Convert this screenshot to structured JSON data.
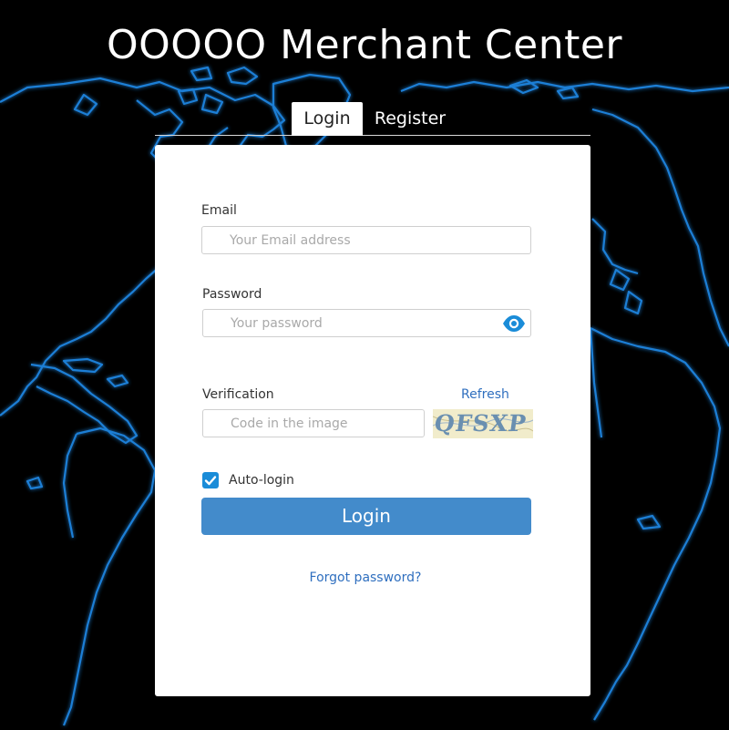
{
  "header": {
    "title": "OOOOO Merchant Center"
  },
  "tabs": [
    {
      "label": "Login",
      "active": true
    },
    {
      "label": "Register",
      "active": false
    }
  ],
  "form": {
    "email": {
      "label": "Email",
      "placeholder": "Your Email address",
      "value": ""
    },
    "password": {
      "label": "Password",
      "placeholder": "Your password",
      "value": "",
      "toggle_icon": "eye-icon"
    },
    "verification": {
      "label": "Verification",
      "placeholder": "Code in the image",
      "value": "",
      "refresh_label": "Refresh",
      "captcha_text": "QFSXP"
    },
    "auto_login": {
      "label": "Auto-login",
      "checked": true
    },
    "login_button": "Login",
    "forgot_link": "Forgot password?"
  },
  "colors": {
    "background": "#000000",
    "map_glow": "#1e7fd6",
    "accent": "#438bcb",
    "link": "#2f6fbf",
    "checkbox": "#1a8cd8"
  }
}
